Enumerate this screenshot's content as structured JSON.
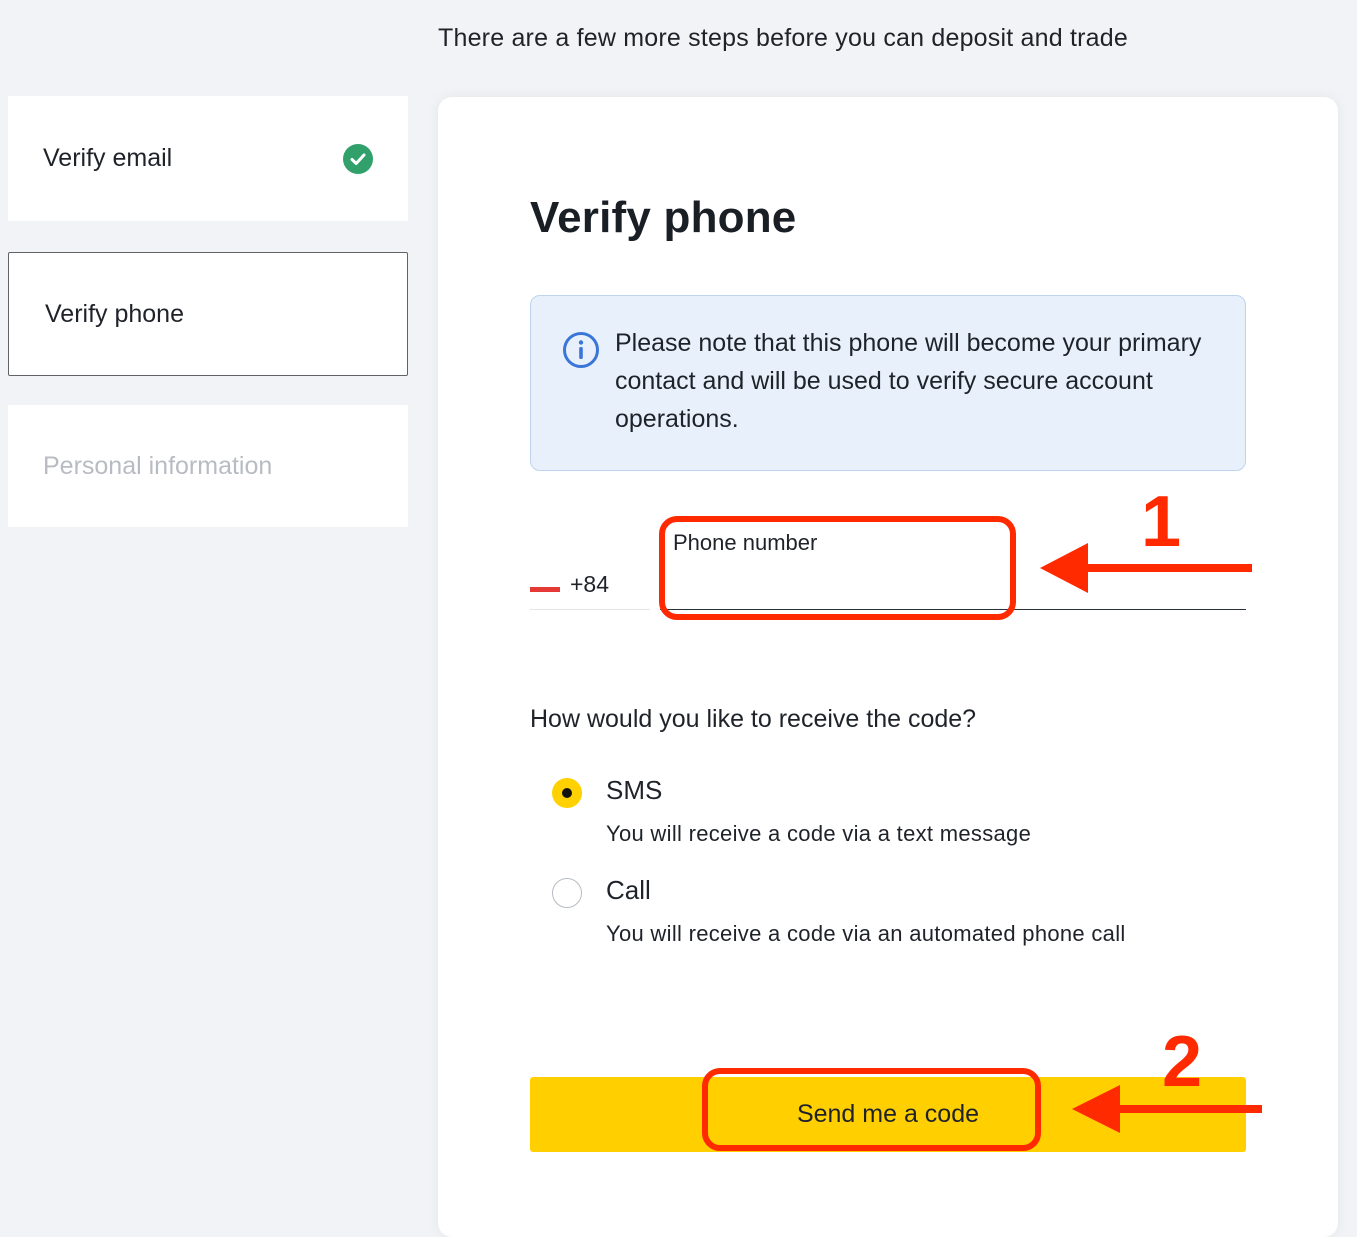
{
  "header": {
    "message": "There are a few more steps before you can deposit and trade"
  },
  "steps": [
    {
      "label": "Verify email",
      "status": "completed"
    },
    {
      "label": "Verify phone",
      "status": "active"
    },
    {
      "label": "Personal information",
      "status": "disabled"
    }
  ],
  "main": {
    "title": "Verify phone",
    "info": {
      "icon": "info-icon",
      "text": "Please note that this phone will become your primary contact and will be used to verify secure account operations."
    },
    "phone": {
      "country_code": "+84",
      "label": "Phone number",
      "value": ""
    },
    "question": "How would you like to receive the code?",
    "options": [
      {
        "title": "SMS",
        "description": "You will receive a code via a text message",
        "selected": true
      },
      {
        "title": "Call",
        "description": "You will receive a code via an automated phone call",
        "selected": false
      }
    ],
    "send_button": "Send me a code"
  },
  "annotations": {
    "step_1": "1",
    "step_2": "2",
    "color": "#ff2a00"
  },
  "colors": {
    "accent_yellow": "#ffcf00",
    "success_green": "#31a06b",
    "info_blue": "#3a76d8",
    "info_bg": "#e8f1fb"
  }
}
